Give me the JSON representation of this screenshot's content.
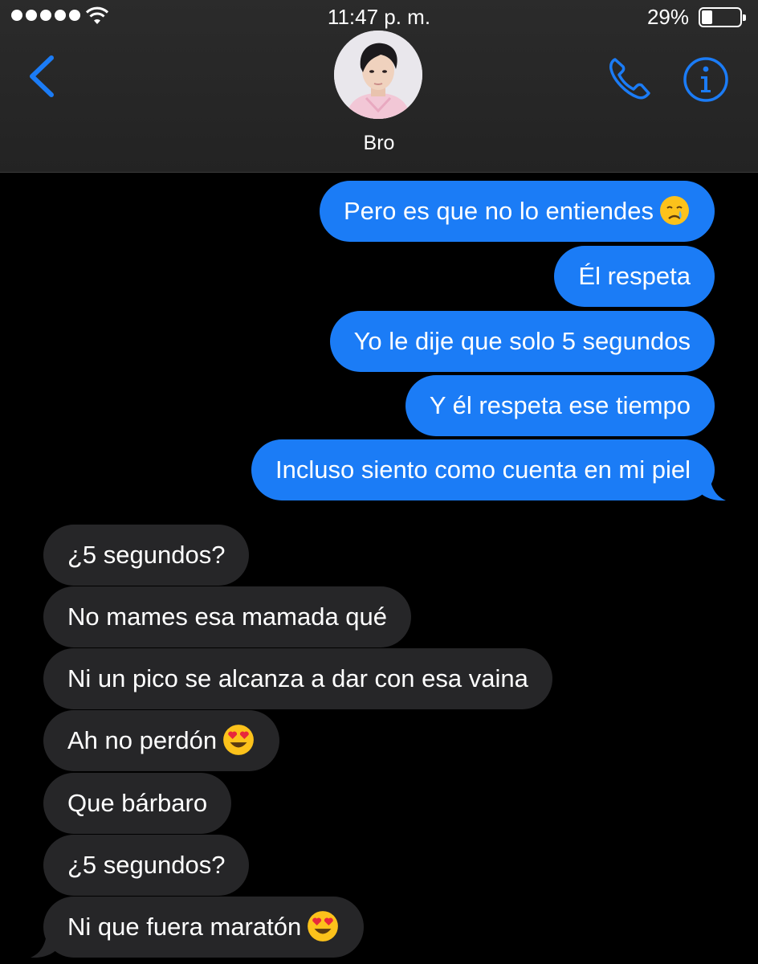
{
  "status": {
    "time": "11:47 p. m.",
    "battery": "29%",
    "battery_level": 0.29
  },
  "header": {
    "contact_name": "Bro"
  },
  "messages": [
    {
      "side": "out",
      "text": "Pero es que no lo entiendes",
      "emoji": "crying-face-icon"
    },
    {
      "side": "out",
      "text": "Él respeta"
    },
    {
      "side": "out",
      "text": "Yo le dije que solo 5 segundos"
    },
    {
      "side": "out",
      "text": "Y él respeta ese tiempo"
    },
    {
      "side": "out",
      "text": "Incluso siento como cuenta en mi piel"
    },
    {
      "side": "in",
      "text": "¿5 segundos?"
    },
    {
      "side": "in",
      "text": "No mames esa mamada qué"
    },
    {
      "side": "in",
      "text": "Ni un pico se alcanza a dar con esa vaina"
    },
    {
      "side": "in",
      "text": "Ah no perdón",
      "emoji": "heart-eyes-face-icon"
    },
    {
      "side": "in",
      "text": "Que bárbaro"
    },
    {
      "side": "in",
      "text": "¿5 segundos?"
    },
    {
      "side": "in",
      "text": "Ni que fuera maratón",
      "emoji": "heart-eyes-face-icon"
    }
  ],
  "colors": {
    "accent": "#1b7cf6",
    "incoming_bubble": "#262628",
    "header_bg": "#2b2b2b"
  }
}
